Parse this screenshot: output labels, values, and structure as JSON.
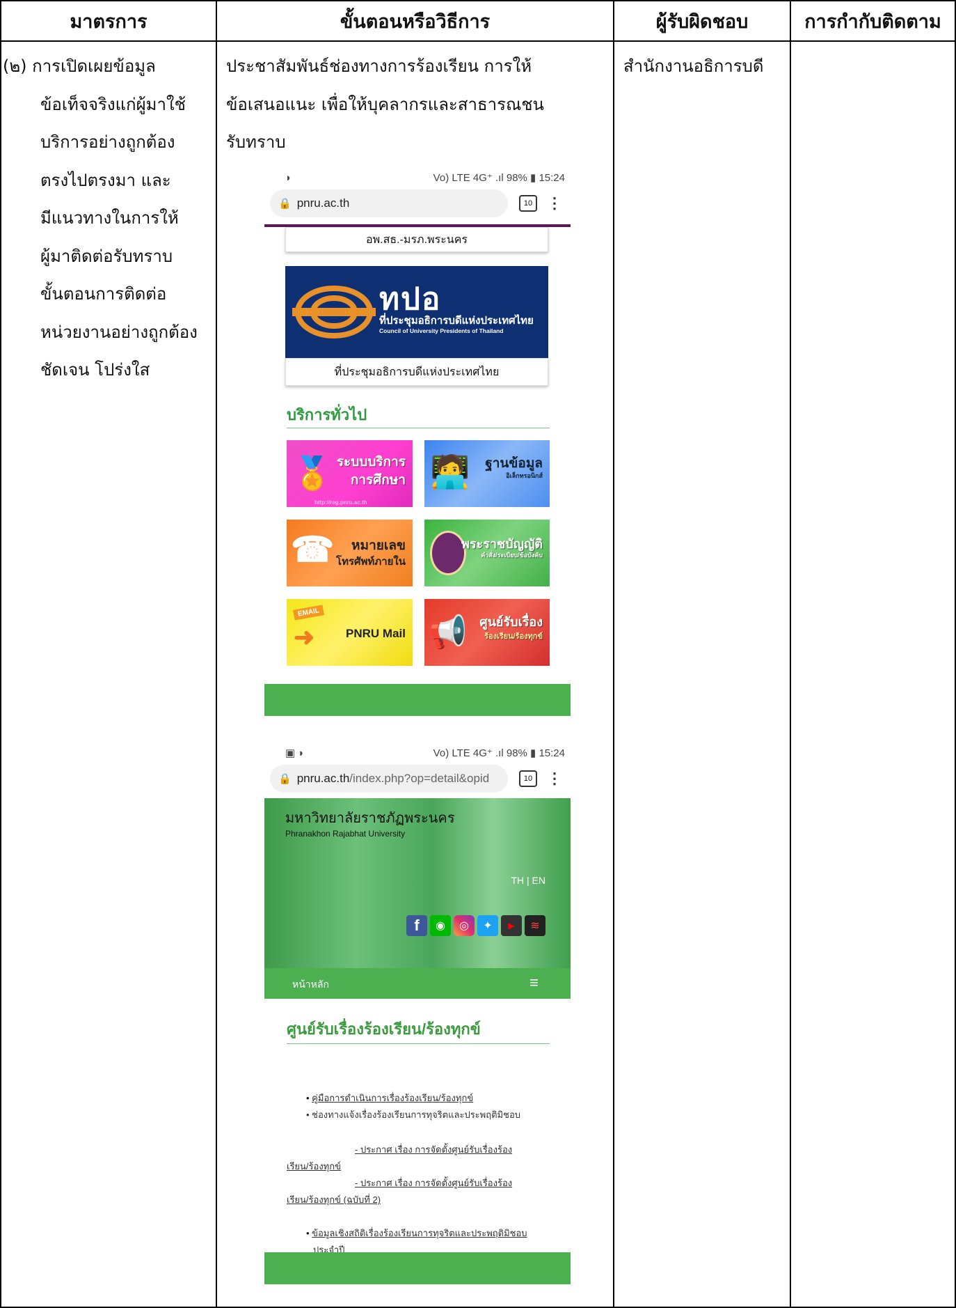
{
  "headers": {
    "col1": "มาตรการ",
    "col2": "ขั้นตอนหรือวิธีการ",
    "col3": "ผู้รับผิดชอบ",
    "col4": "การกำกับติดตาม"
  },
  "measure": {
    "lines": [
      "(๒) การเปิดเผยข้อมูล",
      "ข้อเท็จจริงแก่ผู้มาใช้",
      "บริการอย่างถูกต้อง",
      "ตรงไปตรงมา และ",
      "มีแนวทางในการให้",
      "ผู้มาติดต่อรับทราบ",
      "ขั้นตอนการติดต่อ",
      "หน่วยงานอย่างถูกต้อง",
      "ชัดเจน โปร่งใส"
    ]
  },
  "procedure": {
    "lines": [
      "ประชาสัมพันธ์ช่องทางการร้องเรียน การให้",
      "ข้อเสนอแนะ เพื่อให้บุคลากรและสาธารณชน",
      "รับทราบ"
    ]
  },
  "responsible": "สำนักงานอธิการบดี",
  "phone1": {
    "status_left": "◗",
    "status_right": "Vo) LTE 4G⁺ .ıl 98% ▮ 15:24",
    "url": "pnru.ac.th",
    "tab_count": "10",
    "card_top_caption": "อพ.สธ.-มรภ.พระนคร",
    "banner_title": "ทปอ",
    "banner_sub_th": "ที่ประชุมอธิการบดีแห่งประเทศไทย",
    "banner_sub_en": "Council of University Presidents of Thailand",
    "banner_caption": "ที่ประชุมอธิการบดีแห่งประเทศไทย",
    "section_title": "บริการทั่วไป",
    "tiles": [
      {
        "line1": "ระบบบริการ",
        "line2": "การศึกษา",
        "note": "http://reg.pnru.ac.th"
      },
      {
        "line1": "ฐานข้อมูล",
        "line2": "อิเล็กทรอนิกส์"
      },
      {
        "line1": "หมายเลข",
        "line2": "โทรศัพท์ภายใน"
      },
      {
        "line1": "พระราชบัญญัติ",
        "line2": "คำสั่ง/ระเบียบ/ข้อบังคับ"
      },
      {
        "line1": "PNRU Mail",
        "line2": "EMAIL"
      },
      {
        "line1": "ศูนย์รับเรื่อง",
        "line2": "ร้องเรียน/ร้องทุกข์"
      }
    ]
  },
  "phone2": {
    "status_left": "▣ ◗",
    "status_right": "Vo) LTE 4G⁺ .ıl 98% ▮ 15:24",
    "url_domain": "pnru.ac.th",
    "url_path": "/index.php?op=detail&opid",
    "tab_count": "10",
    "uni_th": "มหาวิทยาลัยราชภัฏพระนคร",
    "uni_en": "Phranakhon Rajabhat University",
    "lang": "TH | EN",
    "menu_home": "หน้าหลัก",
    "page_title": "ศูนย์รับเรื่องร้องเรียน/ร้องทุกข์",
    "items": [
      "คู่มือการดำเนินการเรื่องร้องเรียน/ร้องทุกข์",
      "ช่องทางแจ้งเรื่องร้องเรียนการทุจริตและประพฤติมิชอบ",
      "- ประกาศ เรื่อง การจัดตั้งศูนย์รับเรื่องร้อง",
      "เรียน/ร้องทุกข์",
      "- ประกาศ เรื่อง การจัดตั้งศูนย์รับเรื่องร้อง",
      "เรียน/ร้องทุกข์ (ฉบับที่ 2)",
      "ข้อมูลเชิงสถิติเรื่องร้องเรียนการทุจริตและประพฤติมิชอบ",
      "ประจำปี"
    ]
  }
}
